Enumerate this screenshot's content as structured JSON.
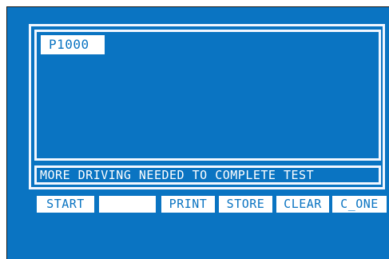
{
  "display": {
    "code": "P1000",
    "message": "MORE DRIVING NEEDED TO COMPLETE TEST"
  },
  "softkeys": {
    "start": "START",
    "blank": "",
    "print": "PRINT",
    "store": "STORE",
    "clear": "CLEAR",
    "c_one": "C_ONE"
  },
  "colors": {
    "screen_background": "#0a74c2",
    "frame": "#f2f7ff",
    "key_background": "#ffffff",
    "key_text": "#0a74c2"
  }
}
